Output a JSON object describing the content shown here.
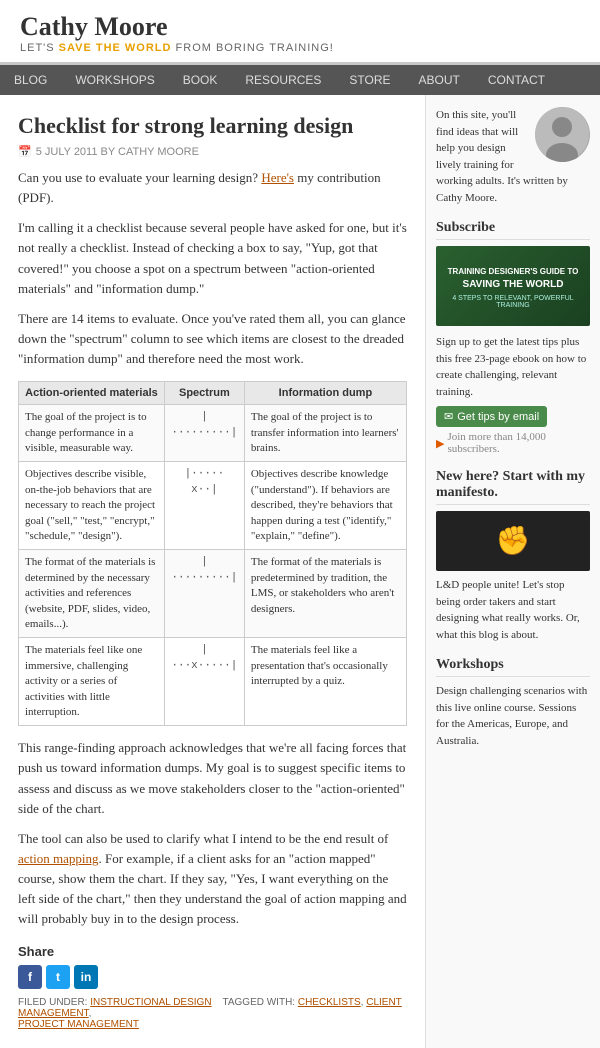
{
  "header": {
    "site_name": "Cathy Moore",
    "tagline_before": "LET'S ",
    "tagline_highlight": "SAVE THE WORLD",
    "tagline_after": " FROM BORING TRAINING!"
  },
  "nav": {
    "items": [
      "BLOG",
      "WORKSHOPS",
      "BOOK",
      "RESOURCES",
      "STORE",
      "ABOUT",
      "CONTACT"
    ]
  },
  "article": {
    "title": "Checklist for strong learning design",
    "meta": "5 JULY 2011 BY CATHY MOORE",
    "paragraphs": [
      "Can you use to evaluate your learning design? Here's my contribution (PDF).",
      "I'm calling it a checklist because several people have asked for one, but it's not really a checklist. Instead of checking a box to say, \"Yup, got that covered!\" you choose a spot on a spectrum between \"action-oriented materials\" and \"information dump.\"",
      "There are 14 items to evaluate. Once you've rated them all, you can glance down the \"spectrum\" column to see which items are closest to the dreaded \"information dump\" and therefore need the most work.",
      "This range-finding approach acknowledges that we're all facing forces that push us toward information dumps. My goal is to suggest specific items to assess and discuss as we move stakeholders closer to the \"action-oriented\" side of the chart.",
      "The tool can also be used to clarify what I intend to be the end result of action mapping. For example, if a client asks for an \"action mapped\" course, show them the chart. If they say, \"Yes, I want everything on the left side of the chart,\" then they understand the goal of action mapping and will probably buy in to the design process."
    ]
  },
  "table": {
    "headers": [
      "Action-oriented materials",
      "Spectrum",
      "Information dump"
    ],
    "rows": [
      {
        "action": "The goal of the project is to change performance in a visible, measurable way.",
        "spectrum": "|·········|",
        "info": "The goal of the project is to transfer information into learners' brains."
      },
      {
        "action": "Objectives describe visible, on-the-job behaviors that are necessary to reach the project goal (\"sell,\" \"test,\" \"encrypt,\" \"schedule,\" \"design\").",
        "spectrum": "|···· ·x··|",
        "info": "Objectives describe knowledge (\"understand\"). If behaviors are described, they're behaviors that happen during a test (\"identify,\" \"explain,\" \"define\")."
      },
      {
        "action": "The format of the materials is determined by the necessary activities and references (website, PDF, slides, video, emails...).",
        "spectrum": "|·········|",
        "info": "The format of the materials is predetermined by tradition, the LMS, or stakeholders who aren't designers."
      },
      {
        "action": "The materials feel like one immersive, challenging activity or a series of activities with little interruption.",
        "spectrum": "|···x·····|",
        "info": "The materials feel like a presentation that's occasionally interrupted by a quiz."
      }
    ]
  },
  "share": {
    "title": "Share",
    "buttons": [
      {
        "label": "f",
        "platform": "facebook"
      },
      {
        "label": "t",
        "platform": "twitter"
      },
      {
        "label": "in",
        "platform": "linkedin"
      }
    ],
    "filed_label": "FILED UNDER:",
    "filed_tags": "INSTRUCTIONAL DESIGN",
    "tagged_label": "TAGGED WITH:",
    "tagged_tags": "CHECKLISTS, CLIENT MANAGEMENT, PROJECT MANAGEMENT"
  },
  "sidebar": {
    "intro_text": "On this site, you'll find ideas that will help you design lively training for working adults. It's written by Cathy Moore.",
    "subscribe": {
      "title": "Subscribe",
      "book_title": "TRAINING DESIGNER'S GUIDE TO",
      "book_subtitle": "SAVING THE WORLD",
      "book_desc": "4 STEPS TO RELEVANT, POWERFUL TRAINING",
      "text": "Sign up to get the latest tips plus this free 23-page ebook on how to create challenging, relevant training.",
      "btn_tips": "Get tips by email",
      "btn_join": "Join more than 14,000 subscribers."
    },
    "new_here": {
      "title": "New here? Start with my manifesto.",
      "text": "L&D people unite! Let's stop being order takers and start designing what really works. Or, what this blog is about."
    },
    "workshops": {
      "title": "Workshops",
      "text": "Design challenging scenarios with this live online course. Sessions for the Americas, Europe, and Australia."
    }
  }
}
